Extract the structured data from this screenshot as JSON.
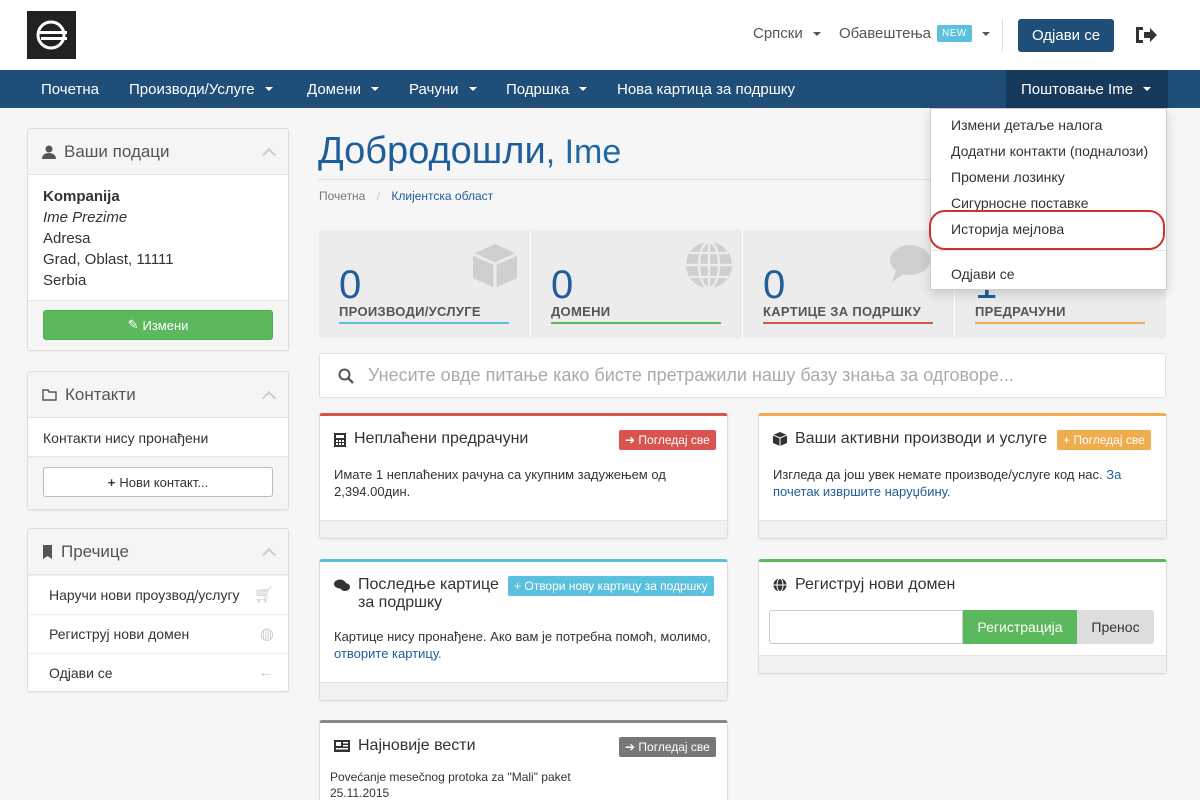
{
  "header": {
    "language": "Српски",
    "notifications": "Обавештења",
    "new_badge": "NEW",
    "logout_button": "Одјави се"
  },
  "nav": {
    "items": [
      "Почетна",
      "Производи/Услуге",
      "Домени",
      "Рачуни",
      "Подршка",
      "Нова картица за подршку"
    ],
    "user": "Поштовање Ime"
  },
  "dropdown": {
    "items": [
      "Измени детаље налога",
      "Додатни контакти (подналози)",
      "Промени лозинку",
      "Сигурносне поставке",
      "Историја мејлова",
      "Одјави се"
    ]
  },
  "sidebar": {
    "your_info_title": "Ваши подаци",
    "company": "Kompanija",
    "name": "Ime Prezime",
    "address": "Adresa",
    "city": "Grad, Oblast, 11111",
    "country": "Serbia",
    "edit_button": "Измени",
    "contacts_title": "Контакти",
    "no_contacts": "Контакти нису пронађени",
    "new_contact_button": "Нови контакт...",
    "shortcuts_title": "Пречице",
    "shortcuts": [
      "Наручи нови проузвод/услугу",
      "Региструј нови домен",
      "Одјави се"
    ]
  },
  "main": {
    "welcome": "Добродошли",
    "welcome_name": ", Ime",
    "breadcrumb_home": "Почетна",
    "breadcrumb_current": "Клијентска област",
    "stats": [
      {
        "value": "0",
        "label": "ПРОИЗВОДИ/УСЛУГЕ",
        "color": "#5bc0de"
      },
      {
        "value": "0",
        "label": "ДОМЕНИ",
        "color": "#5cb85c"
      },
      {
        "value": "0",
        "label": "КАРТИЦЕ ЗА ПОДРШКУ",
        "color": "#d9534f"
      },
      {
        "value": "1",
        "label": "ПРЕДРАЧУНИ",
        "color": "#f0ad4e"
      }
    ],
    "search_placeholder": "Унесите овде питање како бисте претражили нашу базу знања за одговоре...",
    "unpaid": {
      "title": "Неплаћени предрачуни",
      "button": "Погледај све",
      "text": "Имате 1 неплаћених рачуна са укупним задужењем од 2,394.00дин."
    },
    "products": {
      "title": "Ваши активни производи и услуге",
      "button": "Погледај све",
      "text": "Изгледа да још увек немате производе/услуге код нас.",
      "link": "За почетак извршите наруџбину."
    },
    "tickets": {
      "title": "Последње картице за подршку",
      "button": "Отвори нову картицу за подршку",
      "text": "Картице нису пронађене. Ако вам је потребна помоћ, молимо,",
      "link": "отворите картицу."
    },
    "domain": {
      "title": "Региструј нови домен",
      "register_button": "Регистрација",
      "transfer_button": "Пренос"
    },
    "news": {
      "title": "Најновије вести",
      "button": "Погледај све",
      "item_title": "Povećanje mesečnog protoka za \"Mali\" paket",
      "item_date": "25.11.2015"
    }
  }
}
